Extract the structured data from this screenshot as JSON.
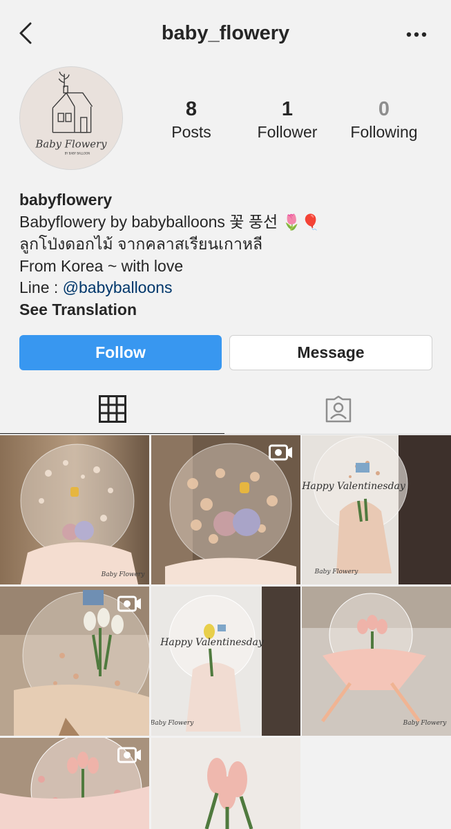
{
  "header": {
    "username": "baby_flowery"
  },
  "profile": {
    "avatar_text": "Baby Flowery",
    "avatar_subtext": "BY BABY BALLOON",
    "stats": [
      {
        "count": "8",
        "label": "Posts"
      },
      {
        "count": "1",
        "label": "Follower"
      },
      {
        "count": "0",
        "label": "Following"
      }
    ],
    "display_name": "babyflowery",
    "bio_line1": "Babyflowery by babyballoons 꽃 풍선",
    "bio_line1_emoji": "🌷🎈",
    "bio_line2": "ลูกโป่งดอกไม้ จากคลาสเรียนเกาหลี",
    "bio_line3": "From Korea ~ with love",
    "bio_line4_prefix": "Line : ",
    "bio_line4_link": "@babyballoons",
    "see_translation": "See Translation"
  },
  "actions": {
    "follow_label": "Follow",
    "message_label": "Message"
  },
  "tabs": [
    {
      "name": "grid",
      "icon": "grid-icon",
      "active": true
    },
    {
      "name": "tagged",
      "icon": "tagged-person-icon",
      "active": false
    }
  ],
  "posts": [
    {
      "overlay_text": "Baby Flowery",
      "video": false
    },
    {
      "overlay_text": "",
      "video": true
    },
    {
      "overlay_text": "Happy Valentinesday",
      "watermark": "Baby Flowery",
      "video": false
    },
    {
      "overlay_text": "",
      "video": true
    },
    {
      "overlay_text": "Happy Valentinesday",
      "watermark": "Baby Flowery",
      "video": false
    },
    {
      "overlay_text": "Baby Flowery",
      "video": false
    },
    {
      "overlay_text": "",
      "video": true
    },
    {
      "overlay_text": "",
      "video": false
    }
  ],
  "colors": {
    "follow_blue": "#3897f0",
    "link_blue": "#00376b",
    "text": "#262626",
    "muted": "#8e8e8e"
  }
}
